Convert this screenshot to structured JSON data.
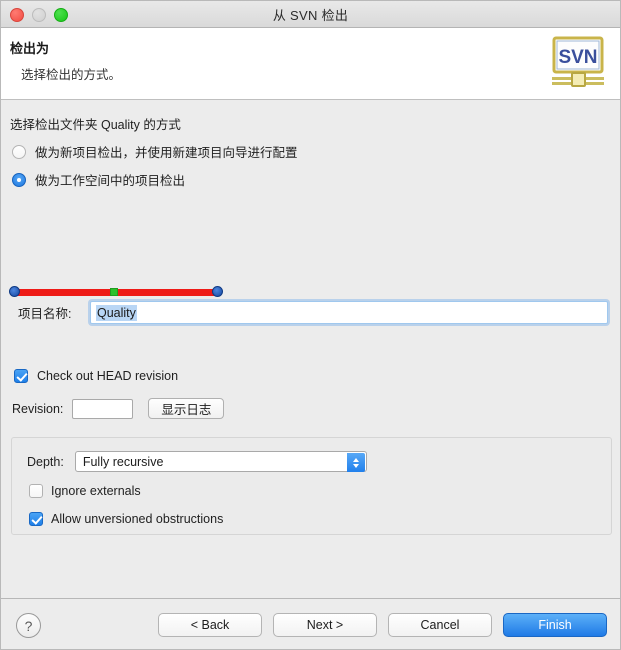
{
  "window": {
    "title": "从 SVN 检出",
    "traffic_lights": [
      "close-red",
      "minimize-gray",
      "maximize-green"
    ]
  },
  "header": {
    "title": "检出为",
    "subtitle": "选择检出的方式。",
    "logo_text": "SVN"
  },
  "main": {
    "section_label": "选择检出文件夹 Quality 的方式",
    "options": [
      {
        "label": "做为新项目检出，并使用新建项目向导进行配置",
        "selected": false
      },
      {
        "label": "做为工作空间中的项目检出",
        "selected": true
      }
    ],
    "annotation": {
      "type": "red-underline-with-handles",
      "line_color": "#ee1b17",
      "endpoint_color": "#15479f",
      "midpoint_color": "#2bc02b"
    },
    "project_name": {
      "label": "项目名称:",
      "value": "Quality",
      "selected": true
    },
    "head_revision": {
      "label": "Check out HEAD revision",
      "checked": true
    },
    "revision": {
      "label": "Revision:",
      "value": "",
      "log_button": "显示日志"
    },
    "depth_group": {
      "depth_label": "Depth:",
      "depth_value": "Fully recursive",
      "depth_options": [
        "Fully recursive"
      ],
      "checkboxes": [
        {
          "label": "Ignore externals",
          "checked": false
        },
        {
          "label": "Allow unversioned obstructions",
          "checked": true
        }
      ]
    }
  },
  "footer": {
    "help": "?",
    "back": "< Back",
    "next": "Next >",
    "cancel": "Cancel",
    "finish": "Finish",
    "primary_color": "#1f7ae6"
  }
}
